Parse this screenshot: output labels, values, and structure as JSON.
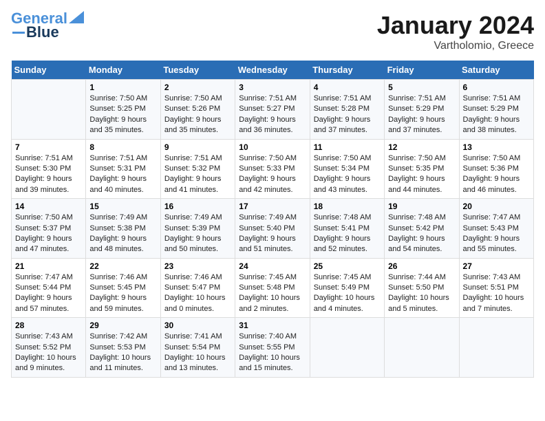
{
  "logo": {
    "line1": "General",
    "line2": "Blue"
  },
  "title": "January 2024",
  "subtitle": "Vartholomio, Greece",
  "days": [
    "Sunday",
    "Monday",
    "Tuesday",
    "Wednesday",
    "Thursday",
    "Friday",
    "Saturday"
  ],
  "weeks": [
    [
      {
        "day": "",
        "content": ""
      },
      {
        "day": "1",
        "content": "Sunrise: 7:50 AM\nSunset: 5:25 PM\nDaylight: 9 hours\nand 35 minutes."
      },
      {
        "day": "2",
        "content": "Sunrise: 7:50 AM\nSunset: 5:26 PM\nDaylight: 9 hours\nand 35 minutes."
      },
      {
        "day": "3",
        "content": "Sunrise: 7:51 AM\nSunset: 5:27 PM\nDaylight: 9 hours\nand 36 minutes."
      },
      {
        "day": "4",
        "content": "Sunrise: 7:51 AM\nSunset: 5:28 PM\nDaylight: 9 hours\nand 37 minutes."
      },
      {
        "day": "5",
        "content": "Sunrise: 7:51 AM\nSunset: 5:29 PM\nDaylight: 9 hours\nand 37 minutes."
      },
      {
        "day": "6",
        "content": "Sunrise: 7:51 AM\nSunset: 5:29 PM\nDaylight: 9 hours\nand 38 minutes."
      }
    ],
    [
      {
        "day": "7",
        "content": "Sunrise: 7:51 AM\nSunset: 5:30 PM\nDaylight: 9 hours\nand 39 minutes."
      },
      {
        "day": "8",
        "content": "Sunrise: 7:51 AM\nSunset: 5:31 PM\nDaylight: 9 hours\nand 40 minutes."
      },
      {
        "day": "9",
        "content": "Sunrise: 7:51 AM\nSunset: 5:32 PM\nDaylight: 9 hours\nand 41 minutes."
      },
      {
        "day": "10",
        "content": "Sunrise: 7:50 AM\nSunset: 5:33 PM\nDaylight: 9 hours\nand 42 minutes."
      },
      {
        "day": "11",
        "content": "Sunrise: 7:50 AM\nSunset: 5:34 PM\nDaylight: 9 hours\nand 43 minutes."
      },
      {
        "day": "12",
        "content": "Sunrise: 7:50 AM\nSunset: 5:35 PM\nDaylight: 9 hours\nand 44 minutes."
      },
      {
        "day": "13",
        "content": "Sunrise: 7:50 AM\nSunset: 5:36 PM\nDaylight: 9 hours\nand 46 minutes."
      }
    ],
    [
      {
        "day": "14",
        "content": "Sunrise: 7:50 AM\nSunset: 5:37 PM\nDaylight: 9 hours\nand 47 minutes."
      },
      {
        "day": "15",
        "content": "Sunrise: 7:49 AM\nSunset: 5:38 PM\nDaylight: 9 hours\nand 48 minutes."
      },
      {
        "day": "16",
        "content": "Sunrise: 7:49 AM\nSunset: 5:39 PM\nDaylight: 9 hours\nand 50 minutes."
      },
      {
        "day": "17",
        "content": "Sunrise: 7:49 AM\nSunset: 5:40 PM\nDaylight: 9 hours\nand 51 minutes."
      },
      {
        "day": "18",
        "content": "Sunrise: 7:48 AM\nSunset: 5:41 PM\nDaylight: 9 hours\nand 52 minutes."
      },
      {
        "day": "19",
        "content": "Sunrise: 7:48 AM\nSunset: 5:42 PM\nDaylight: 9 hours\nand 54 minutes."
      },
      {
        "day": "20",
        "content": "Sunrise: 7:47 AM\nSunset: 5:43 PM\nDaylight: 9 hours\nand 55 minutes."
      }
    ],
    [
      {
        "day": "21",
        "content": "Sunrise: 7:47 AM\nSunset: 5:44 PM\nDaylight: 9 hours\nand 57 minutes."
      },
      {
        "day": "22",
        "content": "Sunrise: 7:46 AM\nSunset: 5:45 PM\nDaylight: 9 hours\nand 59 minutes."
      },
      {
        "day": "23",
        "content": "Sunrise: 7:46 AM\nSunset: 5:47 PM\nDaylight: 10 hours\nand 0 minutes."
      },
      {
        "day": "24",
        "content": "Sunrise: 7:45 AM\nSunset: 5:48 PM\nDaylight: 10 hours\nand 2 minutes."
      },
      {
        "day": "25",
        "content": "Sunrise: 7:45 AM\nSunset: 5:49 PM\nDaylight: 10 hours\nand 4 minutes."
      },
      {
        "day": "26",
        "content": "Sunrise: 7:44 AM\nSunset: 5:50 PM\nDaylight: 10 hours\nand 5 minutes."
      },
      {
        "day": "27",
        "content": "Sunrise: 7:43 AM\nSunset: 5:51 PM\nDaylight: 10 hours\nand 7 minutes."
      }
    ],
    [
      {
        "day": "28",
        "content": "Sunrise: 7:43 AM\nSunset: 5:52 PM\nDaylight: 10 hours\nand 9 minutes."
      },
      {
        "day": "29",
        "content": "Sunrise: 7:42 AM\nSunset: 5:53 PM\nDaylight: 10 hours\nand 11 minutes."
      },
      {
        "day": "30",
        "content": "Sunrise: 7:41 AM\nSunset: 5:54 PM\nDaylight: 10 hours\nand 13 minutes."
      },
      {
        "day": "31",
        "content": "Sunrise: 7:40 AM\nSunset: 5:55 PM\nDaylight: 10 hours\nand 15 minutes."
      },
      {
        "day": "",
        "content": ""
      },
      {
        "day": "",
        "content": ""
      },
      {
        "day": "",
        "content": ""
      }
    ]
  ]
}
